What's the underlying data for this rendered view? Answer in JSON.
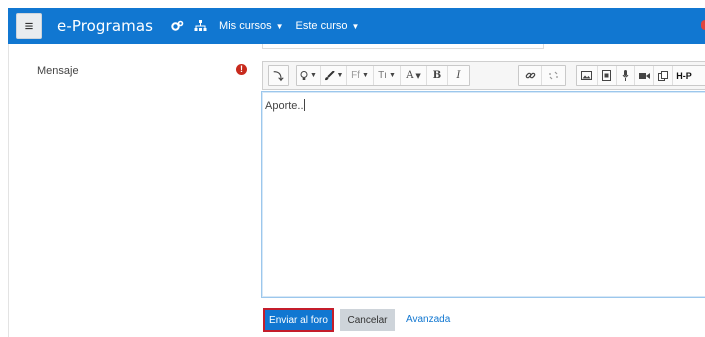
{
  "navbar": {
    "brand": "e-Programas",
    "menus": [
      {
        "label": "Mis cursos",
        "caret": "▼"
      },
      {
        "label": "Este curso",
        "caret": "▼"
      }
    ],
    "icons": [
      "cogs-icon",
      "sitemap-icon",
      "notification-icon"
    ],
    "background": "#1177d1"
  },
  "form": {
    "message_label": "Mensaje",
    "required_icon": "!",
    "editor_text": "Aporte..",
    "submit_label": "Enviar al foro",
    "cancel_label": "Cancelar",
    "advanced_label": "Avanzada"
  },
  "toolbar": {
    "buttons": {
      "collapse": "⤵",
      "font_family": "Ff",
      "font_size": "Tı",
      "font_color": "A",
      "bold": "B",
      "italic": "I",
      "h5p": "H-P"
    }
  },
  "colors": {
    "primary": "#1177d1",
    "required": "#c82a1d",
    "highlight": "#c41d2b"
  }
}
